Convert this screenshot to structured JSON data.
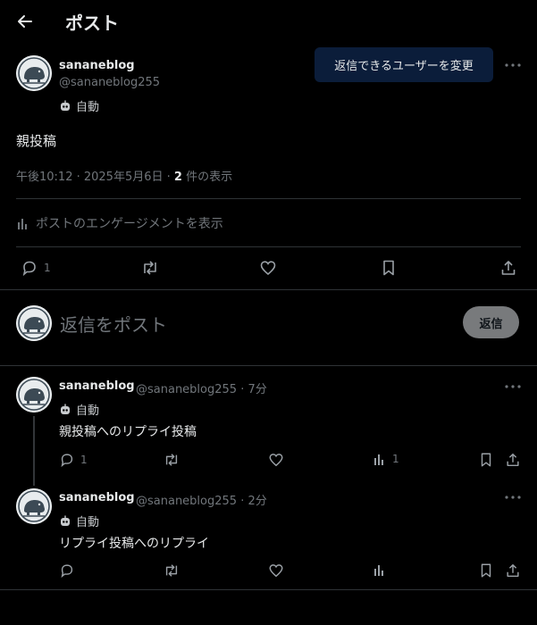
{
  "header": {
    "title": "ポスト",
    "back_icon": "arrow-left-icon"
  },
  "post": {
    "display_name": "sananeblog",
    "handle": "@sananeblog255",
    "auto_label": "自動",
    "text": "親投稿",
    "time": "午後10:12 · 2025年5月6日 · ",
    "views_count": "2",
    "views_label": " 件の表示",
    "tooltip": "返信できるユーザーを変更",
    "engagement_label": "ポストのエンゲージメントを表示",
    "actions": {
      "reply_count": "1"
    }
  },
  "composer": {
    "placeholder": "返信をポスト",
    "submit_label": "返信"
  },
  "replies": [
    {
      "display_name": "sananeblog",
      "handle_time": "@sananeblog255 · 7分",
      "auto_label": "自動",
      "text": "親投稿へのリプライ投稿",
      "reply_count": "1",
      "views_count": "1"
    },
    {
      "display_name": "sananeblog",
      "handle_time": "@sananeblog255 · 2分",
      "auto_label": "自動",
      "text": "リプライ投稿へのリプライ",
      "reply_count": "",
      "views_count": ""
    }
  ],
  "colors": {
    "background": "#000000",
    "text": "#e7e9ea",
    "muted": "#71767b",
    "divider": "#2f3336",
    "tooltip_bg": "#0b1d3a",
    "reply_button": "#787a7c"
  }
}
